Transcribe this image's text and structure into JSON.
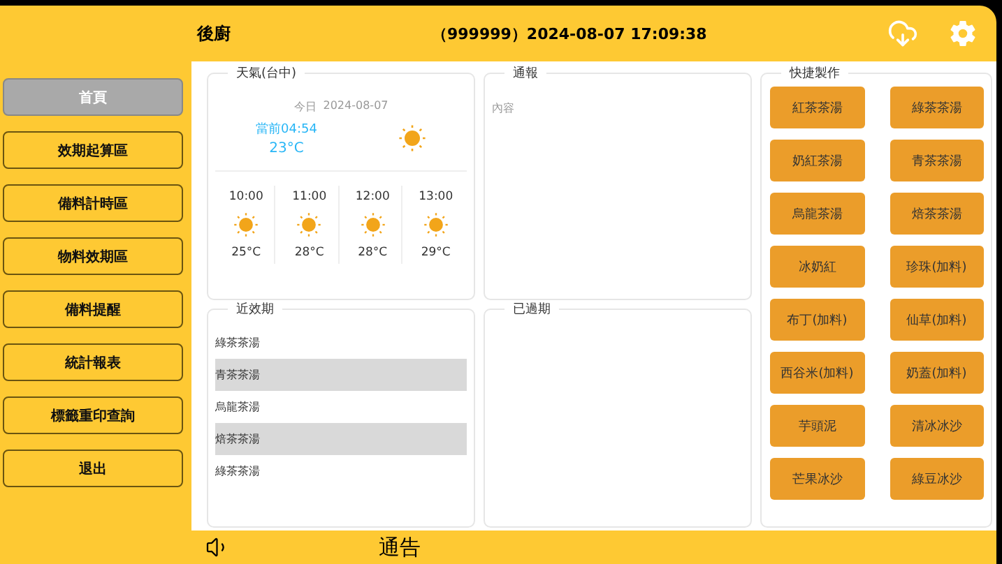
{
  "header": {
    "title": "後廚",
    "info": "（999999）2024-08-07 17:09:38"
  },
  "sidebar": {
    "items": [
      {
        "label": "首頁",
        "selected": true
      },
      {
        "label": "效期起算區",
        "selected": false
      },
      {
        "label": "備料計時區",
        "selected": false
      },
      {
        "label": "物料效期區",
        "selected": false
      },
      {
        "label": "備料提醒",
        "selected": false
      },
      {
        "label": "統計報表",
        "selected": false
      },
      {
        "label": "標籤重印查詢",
        "selected": false
      },
      {
        "label": "退出",
        "selected": false
      }
    ]
  },
  "weather": {
    "legend": "天氣(台中)",
    "date_label": "今日",
    "date": "2024-08-07",
    "now": "當前04:54",
    "temp": "23°C",
    "forecast": [
      {
        "time": "10:00",
        "temp": "25°C"
      },
      {
        "time": "11:00",
        "temp": "28°C"
      },
      {
        "time": "12:00",
        "temp": "28°C"
      },
      {
        "time": "13:00",
        "temp": "29°C"
      }
    ]
  },
  "notice": {
    "legend": "通報",
    "content": "內容"
  },
  "expiring": {
    "legend": "近效期",
    "rows": [
      "綠茶茶湯",
      "青茶茶湯",
      "烏龍茶湯",
      "焙茶茶湯",
      "綠茶茶湯"
    ]
  },
  "expired": {
    "legend": "已過期"
  },
  "quick": {
    "legend": "快捷製作",
    "items": [
      "紅茶茶湯",
      "綠茶茶湯",
      "奶紅茶湯",
      "青茶茶湯",
      "烏龍茶湯",
      "焙茶茶湯",
      "冰奶紅",
      "珍珠(加料)",
      "布丁(加料)",
      "仙草(加料)",
      "西谷米(加料)",
      "奶蓋(加料)",
      "芋頭泥",
      "清冰冰沙",
      "芒果冰沙",
      "綠豆冰沙"
    ]
  },
  "footer": {
    "label": "通告"
  }
}
